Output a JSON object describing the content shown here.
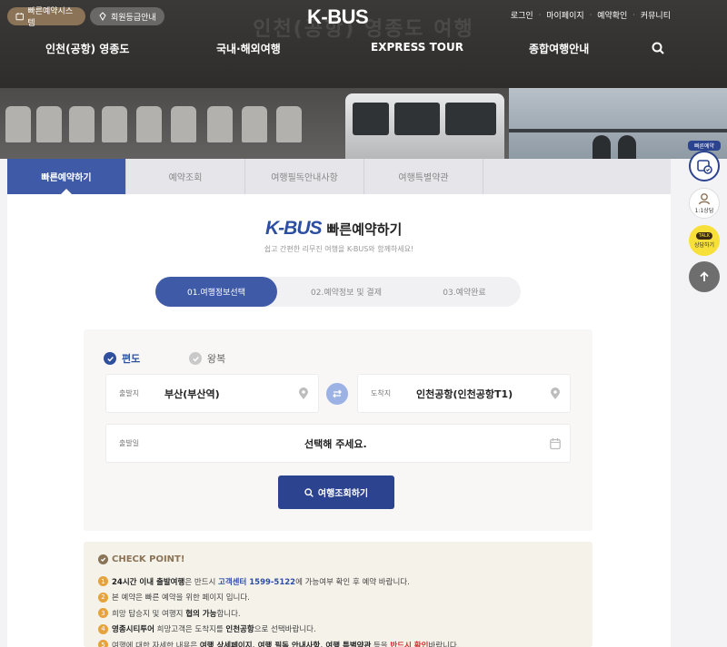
{
  "header": {
    "reserve_system_btn": "빠른예약시스템",
    "member_grade_btn": "회원등급안내",
    "logo_text": "K-BUS",
    "ghost_text": "인천(공항) 영종도 여행",
    "top_links": [
      "로그인",
      "마이페이지",
      "예약확인",
      "커뮤니티"
    ],
    "nav": [
      "인천(공항) 영종도",
      "국내·해외여행",
      "EXPRESS TOUR",
      "종합여행안내"
    ]
  },
  "tabs": [
    "빠른예약하기",
    "예약조회",
    "여행필독안내사항",
    "여행특별약관"
  ],
  "form": {
    "title_logo": "K-BUS",
    "title": "빠른예약하기",
    "subtitle": "쉽고 간편한 리무진 여행을 K-BUS와 함께하세요!",
    "steps": [
      "01.여행정보선택",
      "02.예약정보 및 결제",
      "03.예약완료"
    ],
    "trip_type": {
      "one_way": "편도",
      "round_trip": "왕복",
      "selected": "편도"
    },
    "departure": {
      "label": "출발지",
      "value": "부산(부산역)"
    },
    "arrival": {
      "label": "도착지",
      "value": "인천공항(인천공항T1)"
    },
    "date": {
      "label": "출발일",
      "value": "선택해 주세요."
    },
    "search_btn": "여행조회하기"
  },
  "checkpoint": {
    "title": "CHECK POINT!",
    "items": [
      {
        "n": "1",
        "parts": [
          {
            "t": "24시간 이내 출발여행",
            "s": "bold"
          },
          {
            "t": "은 반드시 "
          },
          {
            "t": "고객센터 1599-5122",
            "s": "blue"
          },
          {
            "t": "에 가능여부 확인 후 예약 바랍니다."
          }
        ]
      },
      {
        "n": "2",
        "parts": [
          {
            "t": "본 예약은 빠른 예약을 위한 페이지 입니다."
          }
        ]
      },
      {
        "n": "3",
        "parts": [
          {
            "t": "희망 탑승지 및 여행지 "
          },
          {
            "t": "협의 가능",
            "s": "bold"
          },
          {
            "t": "합니다."
          }
        ]
      },
      {
        "n": "4",
        "parts": [
          {
            "t": "영종시티투어",
            "s": "bold"
          },
          {
            "t": " 희망고객은 도착지를 "
          },
          {
            "t": "인천공항",
            "s": "bold"
          },
          {
            "t": "으로 선택바랍니다."
          }
        ]
      },
      {
        "n": "5",
        "parts": [
          {
            "t": "여행에 대한 자세한 내용은 "
          },
          {
            "t": "여행 상세페이지, 여행 필독 안내사항, 여행 특별약관",
            "s": "bold"
          },
          {
            "t": " 등을 "
          },
          {
            "t": "반드시 확인",
            "s": "red"
          },
          {
            "t": "바랍니다."
          }
        ]
      }
    ]
  },
  "side": {
    "badge": "빠른예약",
    "chat_label": "1:1상담",
    "kakao_top": "TALK",
    "kakao_label": "상담하기"
  },
  "colors": {
    "primary": "#3f5aa7",
    "button_dark": "#2c438f",
    "accent_gold": "#8a7356",
    "number_orange": "#e6a33b",
    "warning_red": "#d42e2e"
  }
}
